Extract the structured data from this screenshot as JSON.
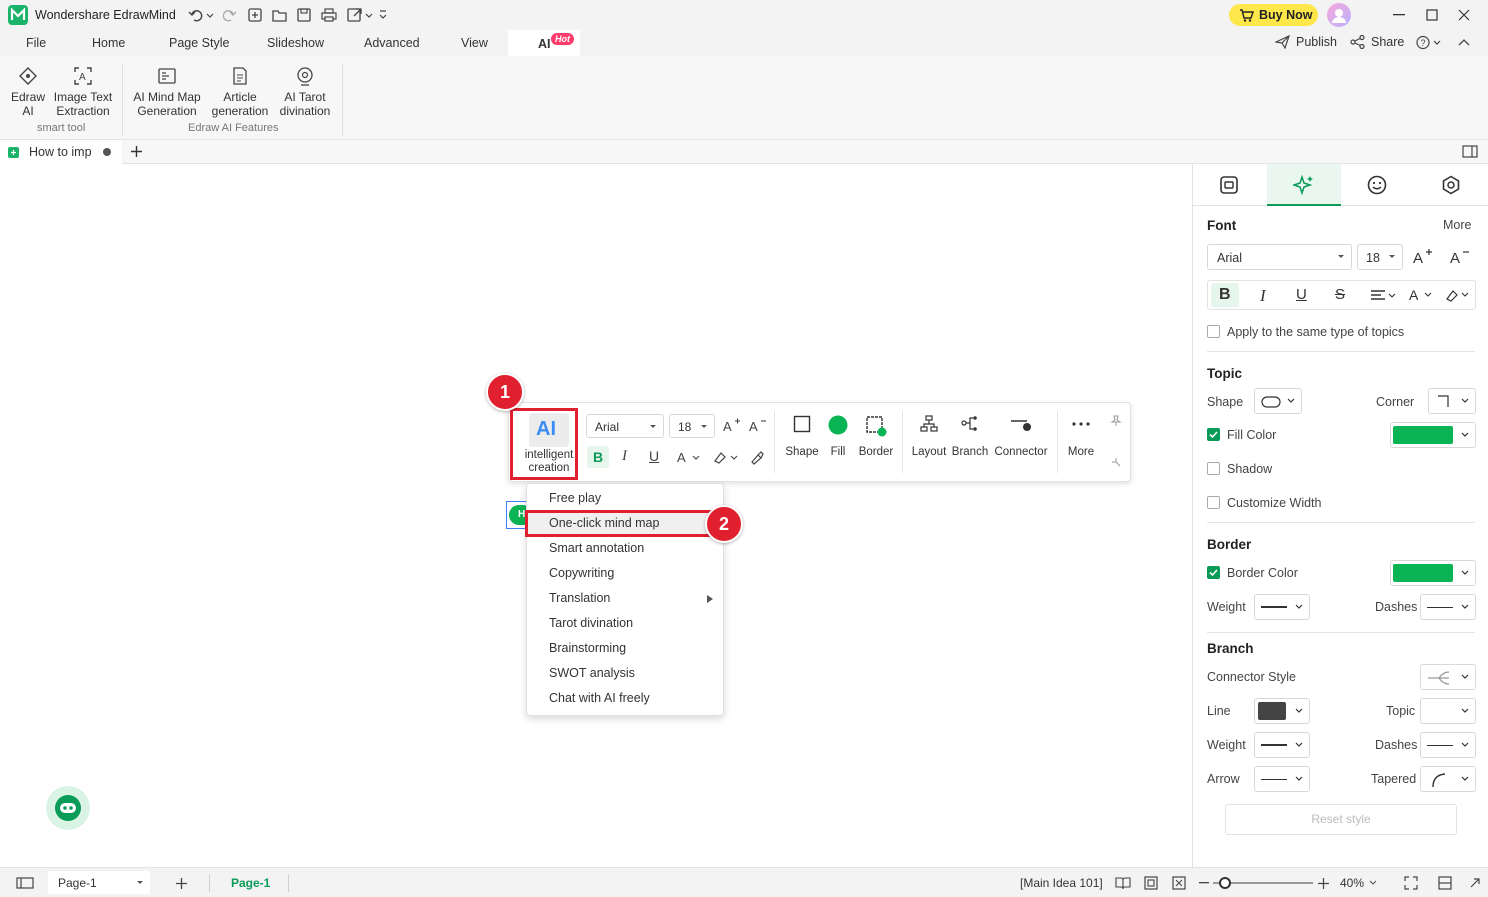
{
  "app": {
    "title": "Wondershare EdrawMind",
    "buy_now": "Buy Now"
  },
  "menu": {
    "items": [
      "File",
      "Home",
      "Page Style",
      "Slideshow",
      "Advanced",
      "View",
      "AI"
    ],
    "hot_badge": "Hot",
    "publish": "Publish",
    "share": "Share"
  },
  "ribbon": {
    "buttons": [
      {
        "line1": "Edraw",
        "line2": "AI"
      },
      {
        "line1": "Image Text",
        "line2": "Extraction"
      },
      {
        "line1": "AI Mind Map",
        "line2": "Generation"
      },
      {
        "line1": "Article",
        "line2": "generation"
      },
      {
        "line1": "AI Tarot",
        "line2": "divination"
      }
    ],
    "groups": [
      "smart tool",
      "Edraw AI Features"
    ]
  },
  "tabs": {
    "doc_tab": "How to imp"
  },
  "floating_toolbar": {
    "ai_label": "AI",
    "ai_caption1": "intelligent",
    "ai_caption2": "creation",
    "font": "Arial",
    "size": "18",
    "tools": [
      "Shape",
      "Fill",
      "Border",
      "Layout",
      "Branch",
      "Connector",
      "More"
    ]
  },
  "context_menu": {
    "items": [
      "Free play",
      "One-click mind map",
      "Smart annotation",
      "Copywriting",
      "Translation",
      "Tarot divination",
      "Brainstorming",
      "SWOT analysis",
      "Chat with AI freely"
    ]
  },
  "annotations": {
    "step1": "1",
    "step2": "2"
  },
  "topic_node": {
    "text": "H"
  },
  "panel": {
    "font_title": "Font",
    "more": "More",
    "font_name": "Arial",
    "font_size": "18",
    "apply_same": "Apply to the same type of topics",
    "topic_title": "Topic",
    "shape_label": "Shape",
    "corner_label": "Corner",
    "fill_color_label": "Fill Color",
    "shadow_label": "Shadow",
    "customize_width_label": "Customize Width",
    "border_title": "Border",
    "border_color_label": "Border Color",
    "weight_label": "Weight",
    "dashes_label": "Dashes",
    "branch_title": "Branch",
    "connector_style_label": "Connector Style",
    "line_label": "Line",
    "topic_label": "Topic",
    "weight2_label": "Weight",
    "dashes2_label": "Dashes",
    "arrow_label": "Arrow",
    "tapered_label": "Tapered",
    "reset_style": "Reset style",
    "fill_color": "#0ab354",
    "border_color": "#0ab354",
    "line_color": "#444444"
  },
  "status": {
    "page_select": "Page-1",
    "page_tab": "Page-1",
    "selection": "[Main Idea 101]",
    "zoom": "40%"
  },
  "colors": {
    "accent": "#0a9b58",
    "annotation_red": "#e0202f"
  }
}
